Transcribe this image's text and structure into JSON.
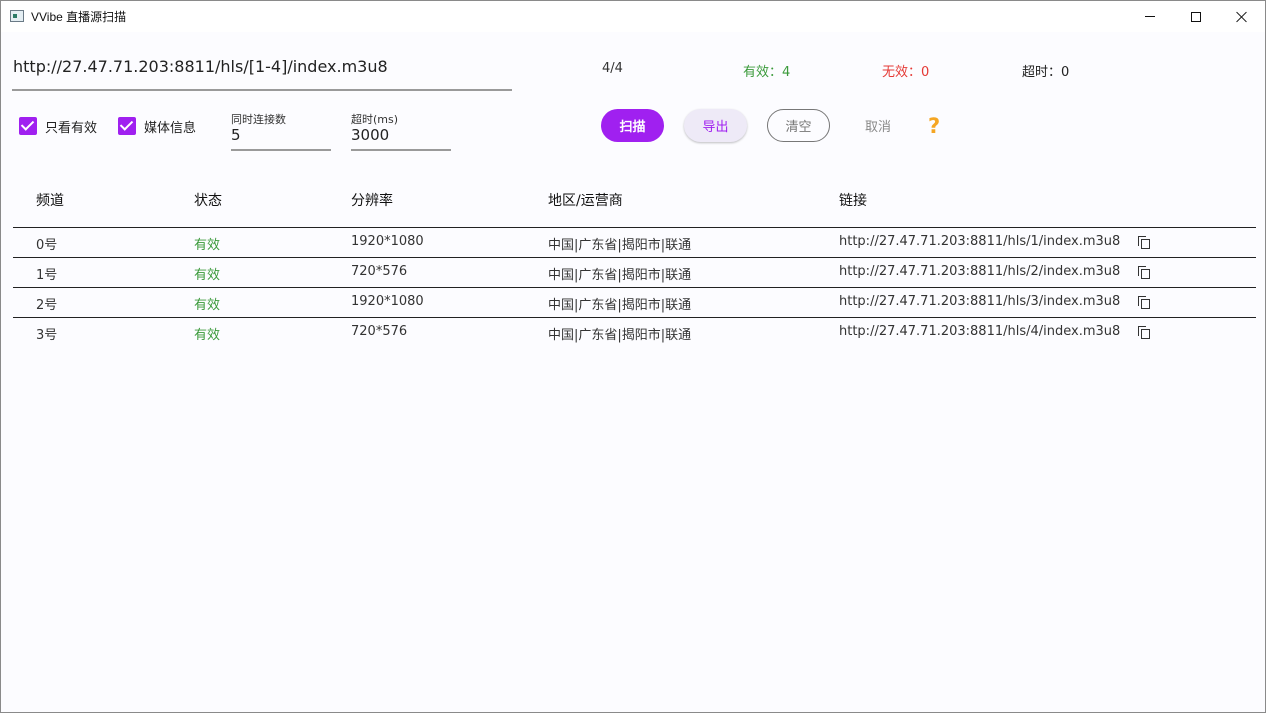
{
  "window": {
    "title": "VVibe 直播源扫描"
  },
  "scan": {
    "url": "http://27.47.71.203:8811/hls/[1-4]/index.m3u8",
    "progress": "4/4",
    "valid": "有效：4",
    "invalid": "无效：0",
    "timeout": "超时：0"
  },
  "options": {
    "only_valid_label": "只看有效",
    "only_valid_checked": true,
    "media_info_label": "媒体信息",
    "media_info_checked": true,
    "connections_label": "同时连接数",
    "connections_value": "5",
    "timeout_label": "超时(ms)",
    "timeout_value": "3000"
  },
  "actions": {
    "scan": "扫描",
    "export": "导出",
    "clear": "清空",
    "cancel": "取消",
    "help": "?"
  },
  "colors": {
    "accent": "#a020f0",
    "valid": "#3a9a3a",
    "invalid": "#e53935",
    "help": "#f5a623"
  },
  "table": {
    "columns": [
      "频道",
      "状态",
      "分辨率",
      "地区/运营商",
      "链接"
    ],
    "rows": [
      {
        "channel": "0号",
        "status": "有效",
        "resolution": "1920*1080",
        "region": "中国|广东省|揭阳市|联通",
        "link": "http://27.47.71.203:8811/hls/1/index.m3u8"
      },
      {
        "channel": "1号",
        "status": "有效",
        "resolution": "720*576",
        "region": "中国|广东省|揭阳市|联通",
        "link": "http://27.47.71.203:8811/hls/2/index.m3u8"
      },
      {
        "channel": "2号",
        "status": "有效",
        "resolution": "1920*1080",
        "region": "中国|广东省|揭阳市|联通",
        "link": "http://27.47.71.203:8811/hls/3/index.m3u8"
      },
      {
        "channel": "3号",
        "status": "有效",
        "resolution": "720*576",
        "region": "中国|广东省|揭阳市|联通",
        "link": "http://27.47.71.203:8811/hls/4/index.m3u8"
      }
    ]
  }
}
